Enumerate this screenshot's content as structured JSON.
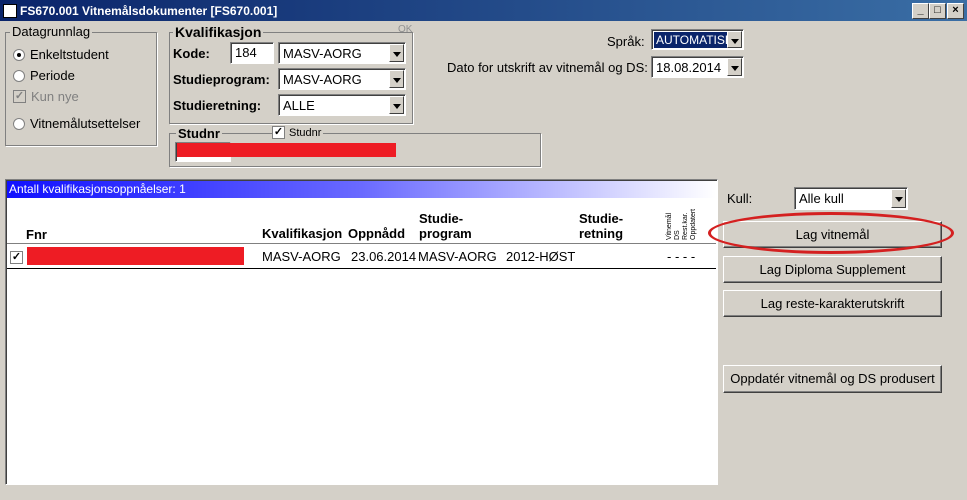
{
  "window": {
    "title": "FS670.001 Vitnemålsdokumenter [FS670.001]",
    "minimize": "_",
    "maximize": "□",
    "close": "×"
  },
  "datagrunnlag": {
    "legend": "Datagrunnlag",
    "options": [
      "Enkeltstudent",
      "Periode",
      "Kun nye",
      "Vitnemålutsettelser"
    ],
    "selected": "Enkeltstudent",
    "kun_nye_checked": "✓"
  },
  "kvalifikasjon": {
    "legend": "Kvalifikasjon",
    "ok": "OK",
    "kode_label": "Kode:",
    "kode_value": "184",
    "kode_combo": "MASV-AORG",
    "studieprogram_label": "Studieprogram:",
    "studieprogram_value": "MASV-AORG",
    "studieretning_label": "Studieretning:",
    "studieretning_value": "ALLE"
  },
  "studnr": {
    "legend": "Studnr",
    "check_label": "Studnr",
    "checked": "✓"
  },
  "sprak": {
    "label": "Språk:",
    "value": "AUTOMATISK"
  },
  "dato": {
    "label": "Dato for utskrift av vitnemål og DS:",
    "value": "18.08.2014"
  },
  "kull": {
    "label": "Kull:",
    "value": "Alle kull"
  },
  "table": {
    "header": "Antall kvalifikasjonsoppnåelser: 1",
    "columns": {
      "fnr": "Fnr",
      "kvalifikasjon": "Kvalifikasjon",
      "oppnadd": "Oppnådd",
      "studieprogram": "Studie-\nprogram",
      "studieretning": "Studie-\nretning",
      "vert1": "Vitnemål",
      "vert2": "DS",
      "vert3": "Rest.kar.",
      "vert4": "Oppdatert"
    },
    "rows": [
      {
        "checked": "✓",
        "kvalifikasjon": "MASV-AORG",
        "oppnadd": "23.06.2014",
        "studieprogram": "MASV-AORG",
        "kull": "2012-HØST",
        "flags": "- - - -"
      }
    ]
  },
  "buttons": {
    "lag_vitnemal": "Lag vitnemål",
    "lag_diploma": "Lag Diploma Supplement",
    "lag_reste": "Lag reste-karakterutskrift",
    "oppdater": "Oppdatér vitnemål og DS produsert"
  },
  "colors": {
    "title_bar": "#0a246a",
    "highlight_ellipse": "#d42020",
    "redaction": "#ee1c24",
    "gradient_start": "#1010ff"
  }
}
